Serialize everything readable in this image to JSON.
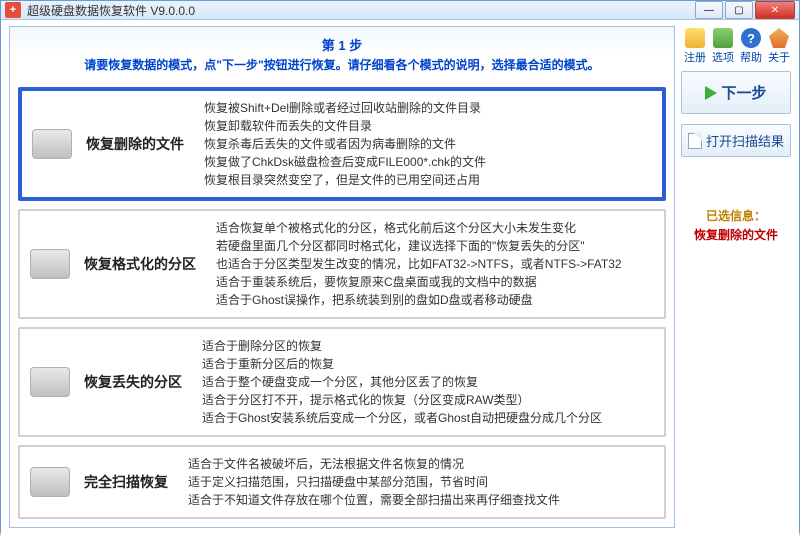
{
  "window": {
    "title": "超级硬盘数据恢复软件 V9.0.0.0"
  },
  "toolbar": {
    "register": "注册",
    "options": "选项",
    "help": "帮助",
    "about": "关于"
  },
  "heading": {
    "step": "第 1 步",
    "instruction": "请要恢复数据的模式，点\"下一步\"按钮进行恢复。请仔细看各个模式的说明，选择最合适的模式。"
  },
  "options": [
    {
      "id": "opt-delete",
      "selected": true,
      "title": "恢复删除的文件",
      "desc": [
        "恢复被Shift+Del删除或者经过回收站删除的文件目录",
        "恢复卸载软件而丢失的文件目录",
        "恢复杀毒后丢失的文件或者因为病毒删除的文件",
        "恢复做了ChkDsk磁盘检查后变成FILE000*.chk的文件",
        "恢复根目录突然变空了，但是文件的已用空间还占用"
      ]
    },
    {
      "id": "opt-format",
      "selected": false,
      "title": "恢复格式化的分区",
      "desc": [
        "适合恢复单个被格式化的分区，格式化前后这个分区大小未发生变化",
        "若硬盘里面几个分区都同时格式化，建议选择下面的\"恢复丢失的分区\"",
        "也适合于分区类型发生改变的情况，比如FAT32->NTFS，或者NTFS->FAT32",
        "适合于重装系统后，要恢复原来C盘桌面或我的文档中的数据",
        "适合于Ghost误操作，把系统装到别的盘如D盘或者移动硬盘"
      ]
    },
    {
      "id": "opt-lostpart",
      "selected": false,
      "title": "恢复丢失的分区",
      "desc": [
        "适合于删除分区的恢复",
        "适合于重新分区后的恢复",
        "适合于整个硬盘变成一个分区，其他分区丢了的恢复",
        "适合于分区打不开，提示格式化的恢复（分区变成RAW类型）",
        "适合于Ghost安装系统后变成一个分区，或者Ghost自动把硬盘分成几个分区"
      ]
    },
    {
      "id": "opt-fullscan",
      "selected": false,
      "title": "完全扫描恢复",
      "desc": [
        "适合于文件名被破坏后，无法根据文件名恢复的情况",
        "适于定义扫描范围，只扫描硬盘中某部分范围，节省时间",
        "适合于不知道文件存放在哪个位置，需要全部扫描出来再仔细查找文件"
      ]
    }
  ],
  "side": {
    "next": "下一步",
    "open_result": "打开扫描结果",
    "selinfo_h": "已选信息：",
    "selinfo_v": "恢复删除的文件"
  }
}
